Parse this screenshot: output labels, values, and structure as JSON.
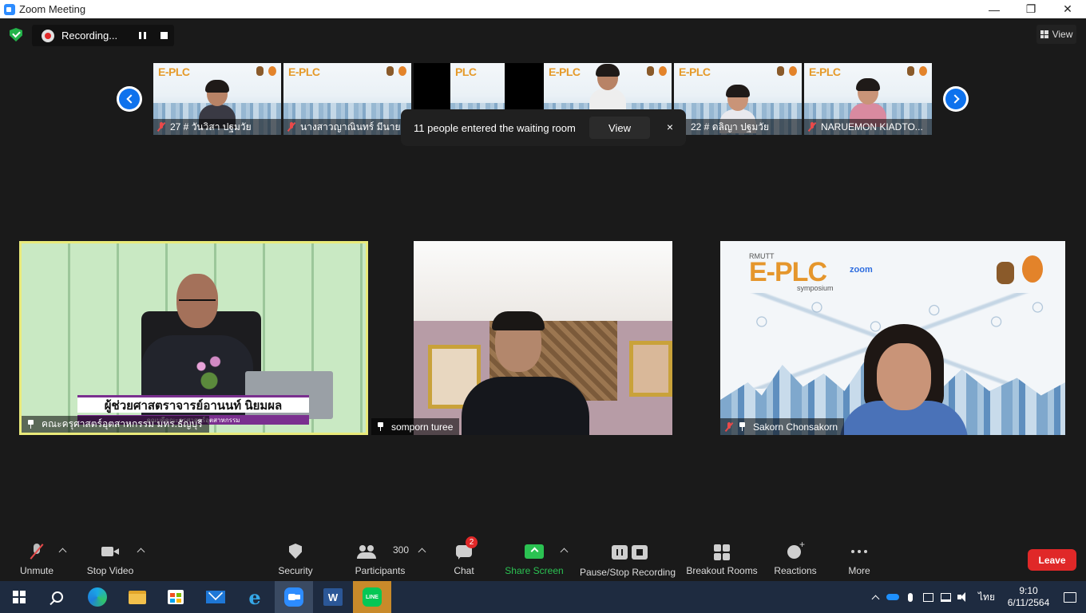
{
  "window": {
    "title": "Zoom Meeting",
    "minimize": "—",
    "maximize": "❐",
    "close": "✕"
  },
  "recording": {
    "label": "Recording..."
  },
  "view_button": {
    "label": "View"
  },
  "thumbnails": [
    {
      "name": "27 # วันวิสา ปฐมวัย",
      "muted": true
    },
    {
      "name": "นางสาวญาณินทร์ มีนายน",
      "muted": true
    },
    {
      "name": "22 # ดลิญา ปฐมวัย",
      "muted": true
    },
    {
      "name": "NARUEMON  KIADTO...",
      "muted": true
    }
  ],
  "notification": {
    "message": "11 people entered the waiting room",
    "action": "View",
    "close": "×"
  },
  "tiles": [
    {
      "name": "คณะครุศาสตร์อุตสาหกรรม มทร.ธัญบุรี",
      "caption_main": "ผู้ช่วยศาสตราจารย์อานนท์ นิยมผล",
      "caption_sub": "คณบดีคณะครุศาสตร์อุตสาหกรรม",
      "active_speaker": true
    },
    {
      "name": "somporn turee",
      "active_speaker": false
    },
    {
      "name": "Sakorn  Chonsakorn",
      "muted": true,
      "bg_title": "E-PLC",
      "bg_org": "RMUTT",
      "bg_sub": "symposium",
      "bg_zoom": "zoom"
    }
  ],
  "toolbar": {
    "unmute": "Unmute",
    "stop_video": "Stop Video",
    "security": "Security",
    "participants": "Participants",
    "participants_count": "300",
    "chat": "Chat",
    "chat_badge": "2",
    "share_screen": "Share Screen",
    "pause_stop_recording": "Pause/Stop Recording",
    "breakout_rooms": "Breakout Rooms",
    "reactions": "Reactions",
    "more": "More",
    "leave": "Leave"
  },
  "taskbar": {
    "word_label": "W",
    "line_label": "LINE",
    "ie_label": "e",
    "language": "ไทย",
    "time": "9:10",
    "date": "6/11/2564"
  },
  "colors": {
    "zoom_blue": "#0e72ed",
    "share_green": "#2bc252",
    "leave_red": "#e02828",
    "active_speaker_border": "#e9ea7a",
    "taskbar_bg": "#1e2b40"
  }
}
